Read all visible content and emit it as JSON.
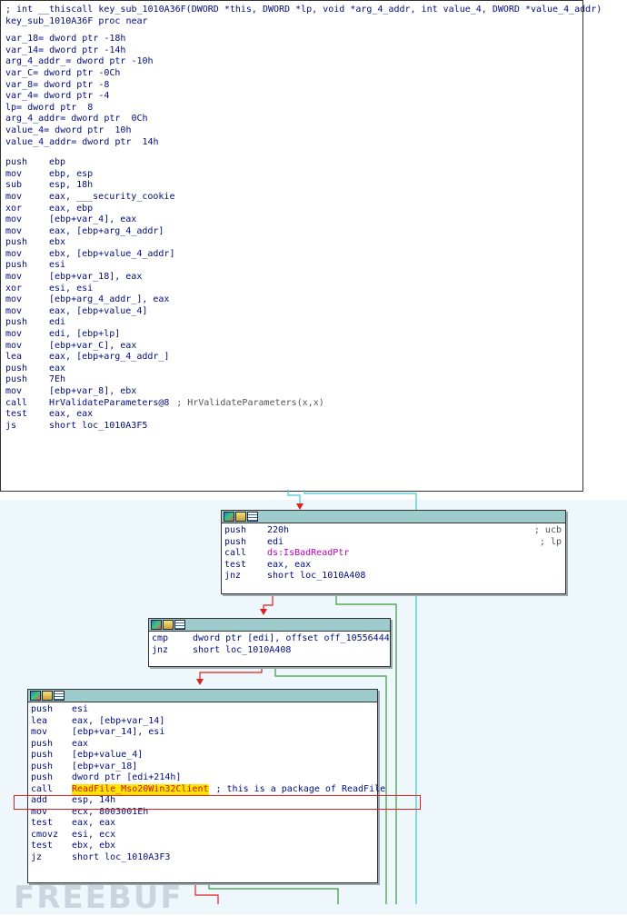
{
  "main_block": {
    "header_lines": [
      "; int __thiscall key_sub_1010A36F(DWORD *this, DWORD *lp, void *arg_4_addr, int value_4, DWORD *value_4_addr)",
      "key_sub_1010A36F proc near"
    ],
    "vars": [
      "var_18= dword ptr -18h",
      "var_14= dword ptr -14h",
      "arg_4_addr_= dword ptr -10h",
      "var_C= dword ptr -0Ch",
      "var_8= dword ptr -8",
      "var_4= dword ptr -4",
      "lp= dword ptr  8",
      "arg_4_addr= dword ptr  0Ch",
      "value_4= dword ptr  10h",
      "value_4_addr= dword ptr  14h"
    ],
    "instructions": [
      {
        "m": "push",
        "o": "ebp",
        "c": ""
      },
      {
        "m": "mov",
        "o": "ebp, esp",
        "c": ""
      },
      {
        "m": "sub",
        "o": "esp, 18h",
        "c": ""
      },
      {
        "m": "mov",
        "o": "eax, ___security_cookie",
        "c": ""
      },
      {
        "m": "xor",
        "o": "eax, ebp",
        "c": ""
      },
      {
        "m": "mov",
        "o": "[ebp+var_4], eax",
        "c": ""
      },
      {
        "m": "mov",
        "o": "eax, [ebp+arg_4_addr]",
        "c": ""
      },
      {
        "m": "push",
        "o": "ebx",
        "c": ""
      },
      {
        "m": "mov",
        "o": "ebx, [ebp+value_4_addr]",
        "c": ""
      },
      {
        "m": "push",
        "o": "esi",
        "c": ""
      },
      {
        "m": "mov",
        "o": "[ebp+var_18], eax",
        "c": ""
      },
      {
        "m": "xor",
        "o": "esi, esi",
        "c": ""
      },
      {
        "m": "mov",
        "o": "[ebp+arg_4_addr_], eax",
        "c": ""
      },
      {
        "m": "mov",
        "o": "eax, [ebp+value_4]",
        "c": ""
      },
      {
        "m": "push",
        "o": "edi",
        "c": ""
      },
      {
        "m": "mov",
        "o": "edi, [ebp+lp]",
        "c": ""
      },
      {
        "m": "mov",
        "o": "[ebp+var_C], eax",
        "c": ""
      },
      {
        "m": "lea",
        "o": "eax, [ebp+arg_4_addr_]",
        "c": ""
      },
      {
        "m": "push",
        "o": "eax",
        "c": ""
      },
      {
        "m": "push",
        "o": "7Eh",
        "c": ""
      },
      {
        "m": "mov",
        "o": "[ebp+var_8], ebx",
        "c": ""
      },
      {
        "m": "call",
        "o": "HrValidateParameters@8",
        "c": "; HrValidateParameters(x,x)"
      },
      {
        "m": "test",
        "o": "eax, eax",
        "c": ""
      },
      {
        "m": "js",
        "o": "short loc_1010A3F5",
        "c": ""
      }
    ]
  },
  "block2": {
    "instructions": [
      {
        "m": "push",
        "o": "220h",
        "c": "; ucb"
      },
      {
        "m": "push",
        "o": "edi",
        "c": "; lp"
      },
      {
        "m": "call",
        "o": "ds:IsBadReadPtr",
        "c": ""
      },
      {
        "m": "test",
        "o": "eax, eax",
        "c": ""
      },
      {
        "m": "jnz",
        "o": "short loc_1010A408",
        "c": ""
      }
    ]
  },
  "block3": {
    "instructions": [
      {
        "m": "cmp",
        "o": "dword ptr [edi], offset off_10556444",
        "c": ""
      },
      {
        "m": "jnz",
        "o": "short loc_1010A408",
        "c": ""
      }
    ]
  },
  "block4": {
    "instructions": [
      {
        "m": "push",
        "o": "esi",
        "c": ""
      },
      {
        "m": "lea",
        "o": "eax, [ebp+var_14]",
        "c": ""
      },
      {
        "m": "mov",
        "o": "[ebp+var_14], esi",
        "c": ""
      },
      {
        "m": "push",
        "o": "eax",
        "c": ""
      },
      {
        "m": "push",
        "o": "[ebp+value_4]",
        "c": ""
      },
      {
        "m": "push",
        "o": "[ebp+var_18]",
        "c": ""
      },
      {
        "m": "push",
        "o": "dword ptr [edi+214h]",
        "c": ""
      },
      {
        "m": "call",
        "o": "ReadFile_Mso20Win32Client",
        "c": "; this is a package of ReadFile"
      },
      {
        "m": "add",
        "o": "esp, 14h",
        "c": ""
      },
      {
        "m": "mov",
        "o": "ecx, 8003001Eh",
        "c": ""
      },
      {
        "m": "test",
        "o": "eax, eax",
        "c": ""
      },
      {
        "m": "cmovz",
        "o": "esi, ecx",
        "c": ""
      },
      {
        "m": "test",
        "o": "ebx, ebx",
        "c": ""
      },
      {
        "m": "jz",
        "o": "short loc_1010A3F3",
        "c": ""
      }
    ]
  },
  "watermark": "FREEBUF",
  "colors": {
    "code": "#000d80",
    "highlight": "#ffe600",
    "annotation_box": "#e02020",
    "edge_red": "#e02020",
    "edge_green": "#3a9a3a",
    "edge_cyan": "#3cc8d8",
    "header": "#9ecbcc"
  }
}
